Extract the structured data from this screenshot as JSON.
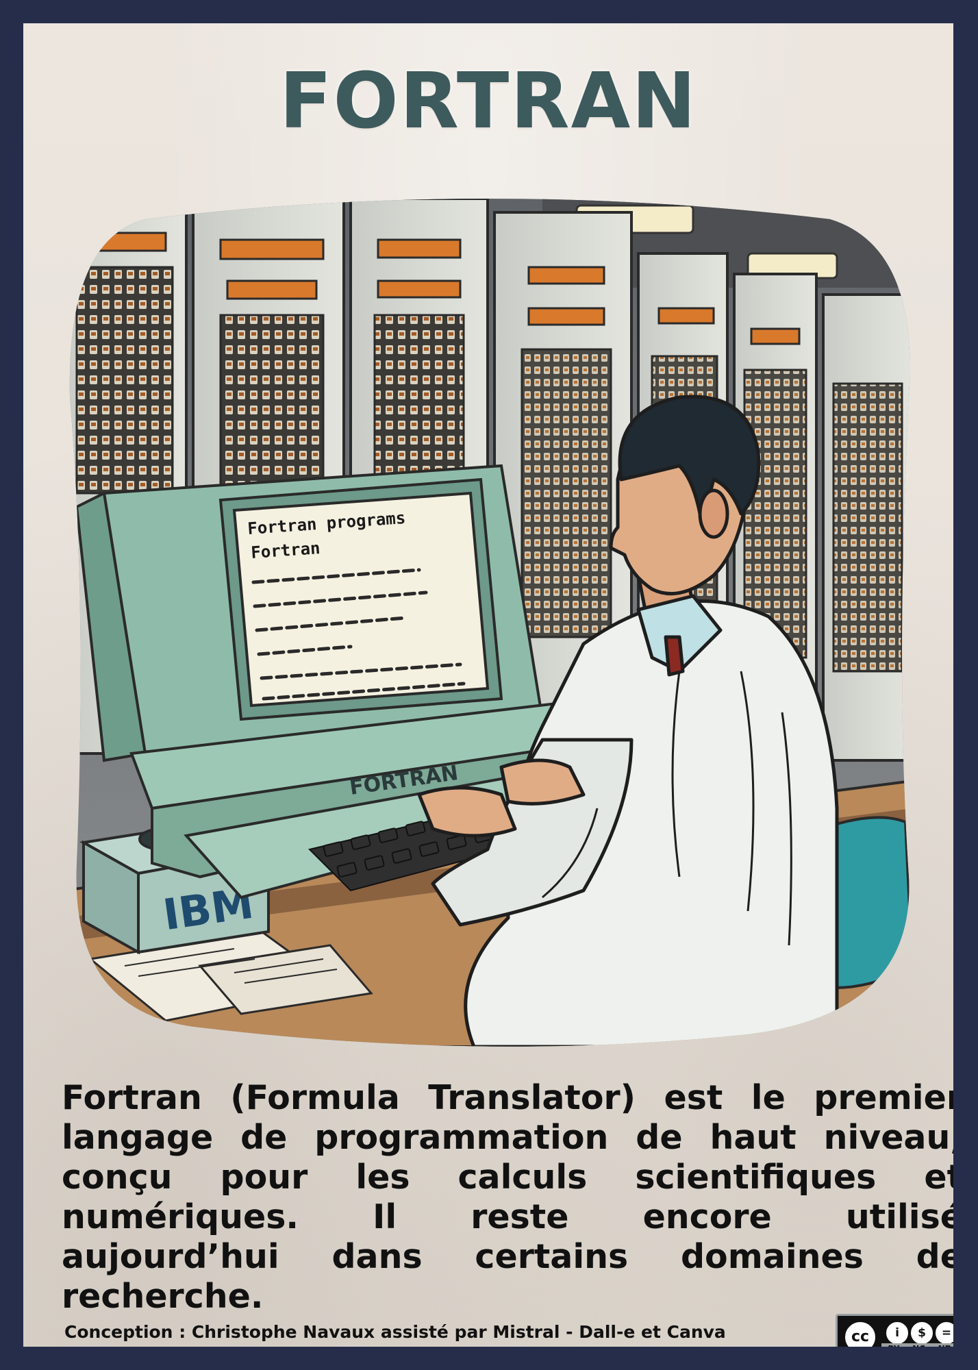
{
  "card": {
    "title": "FORTRAN",
    "illustration": {
      "monitor_screen_lines": [
        "Fortran programs",
        "Fortran"
      ],
      "monitor_brand": "FORTRAN",
      "device_brand": "IBM"
    },
    "description": "Fortran (Formula Translator) est le premier langage de programmation de haut niveau, conçu pour les calculs scientifiques et numériques. Il reste encore utilisé aujourd’hui dans certains domaines de recherche.",
    "credit": "Conception : Christophe Navaux  assisté par Mistral - Dall-e et Canva",
    "license": {
      "cc": "cc",
      "labels": [
        "BY",
        "NC",
        "ND"
      ]
    }
  },
  "colors": {
    "frame": "#252d4a",
    "paper": "#ece6df",
    "title": "#3d5a5c",
    "text": "#111111"
  }
}
